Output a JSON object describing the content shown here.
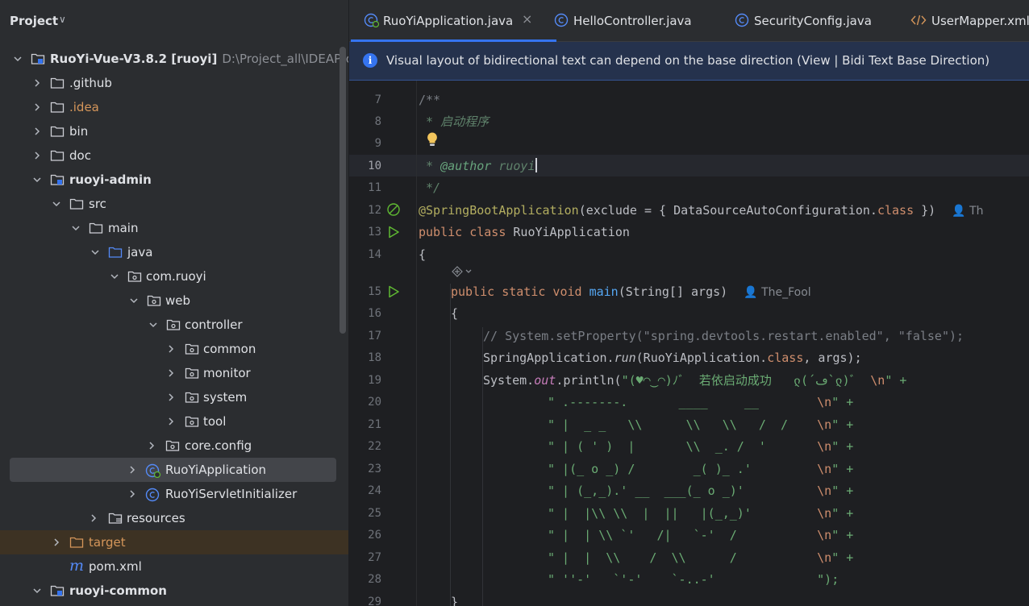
{
  "project_panel": {
    "title": "Project",
    "tree": [
      {
        "label": "RuoYi-Vue-V3.8.2",
        "badge": "[ruoyi]",
        "path": "D:\\Project_all\\IDEAProjects",
        "expanded": true,
        "icon": "module-folder-icon"
      },
      {
        "label": ".github",
        "expanded": false,
        "icon": "folder-icon"
      },
      {
        "label": ".idea",
        "expanded": false,
        "icon": "folder-icon"
      },
      {
        "label": "bin",
        "expanded": false,
        "icon": "folder-icon"
      },
      {
        "label": "doc",
        "expanded": false,
        "icon": "folder-icon"
      },
      {
        "label": "ruoyi-admin",
        "expanded": true,
        "icon": "module-folder-icon"
      },
      {
        "label": "src",
        "expanded": true,
        "icon": "folder-icon"
      },
      {
        "label": "main",
        "expanded": true,
        "icon": "folder-icon"
      },
      {
        "label": "java",
        "expanded": true,
        "icon": "source-folder-icon"
      },
      {
        "label": "com.ruoyi",
        "expanded": true,
        "icon": "package-icon"
      },
      {
        "label": "web",
        "expanded": true,
        "icon": "package-icon"
      },
      {
        "label": "controller",
        "expanded": true,
        "icon": "package-icon"
      },
      {
        "label": "common",
        "expanded": false,
        "icon": "package-icon"
      },
      {
        "label": "monitor",
        "expanded": false,
        "icon": "package-icon"
      },
      {
        "label": "system",
        "expanded": false,
        "icon": "package-icon"
      },
      {
        "label": "tool",
        "expanded": false,
        "icon": "package-icon"
      },
      {
        "label": "core.config",
        "expanded": false,
        "icon": "package-icon"
      },
      {
        "label": "RuoYiApplication",
        "expanded": false,
        "icon": "spring-boot-class-icon"
      },
      {
        "label": "RuoYiServletInitializer",
        "expanded": false,
        "icon": "class-icon"
      },
      {
        "label": "resources",
        "expanded": false,
        "icon": "resources-folder-icon"
      },
      {
        "label": "target",
        "expanded": false,
        "icon": "excluded-folder-icon"
      },
      {
        "label": "pom.xml",
        "icon": "maven-icon"
      },
      {
        "label": "ruoyi-common",
        "expanded": true,
        "icon": "module-folder-icon"
      }
    ]
  },
  "tabs": [
    {
      "label": "RuoYiApplication.java",
      "active": true,
      "close": "×",
      "icon": "spring-boot-class-icon"
    },
    {
      "label": "HelloController.java",
      "icon": "class-icon"
    },
    {
      "label": "SecurityConfig.java",
      "icon": "class-icon"
    },
    {
      "label": "UserMapper.xml",
      "icon": "xml-icon"
    }
  ],
  "notice": {
    "icon": "i",
    "text": "Visual layout of bidirectional text can depend on the base direction (View | Bidi Text Base Direction)"
  },
  "editor": {
    "line_numbers": [
      "7",
      "8",
      "9",
      "10",
      "11",
      "12",
      "13",
      "14",
      "15",
      "16",
      "17",
      "18",
      "19",
      "20",
      "21",
      "22",
      "23",
      "24",
      "25",
      "26",
      "27",
      "28",
      "29"
    ],
    "current_line": "10",
    "code": {
      "l7": "/**",
      "l8": " * 启动程序",
      "l10_star": " * ",
      "l10_tag": "@author",
      "l10_val": " ruoyi",
      "l11": " */",
      "l12_ann": "@SpringBootApplication",
      "l12_rest": "(exclude = { DataSourceAutoConfiguration.",
      "l12_kw": "class",
      "l12_end": " })",
      "l12_hint": "Th",
      "l13_kw": "public class",
      "l13_name": " RuoYiApplication",
      "l14": "{",
      "l15_kw": "public static void",
      "l15_fn": "main",
      "l15_rest": "(String[] args)",
      "l15_hint": "The_Fool",
      "l16": "{",
      "l17": "// System.setProperty(\"spring.devtools.restart.enabled\", \"false\");",
      "l18_a": "SpringApplication.",
      "l18_run": "run",
      "l18_b": "(RuoYiApplication.",
      "l18_kw": "class",
      "l18_c": ", args);",
      "l19_a": "System.",
      "l19_out": "out",
      "l19_b": ".println(",
      "l19_str": "\"(♥◠‿◠)ﾉﾞ  若依启动成功   ლ(´ڡ`ლ)ﾞ  ",
      "l19_esc": "\\n",
      "l19_end": "\" +",
      "art": [
        "\" .-------.       ____     __        ",
        "\" |  _ _   \\\\      \\\\   \\\\   /  /    ",
        "\" | ( ' )  |       \\\\  _. /  '       ",
        "\" |(_ o _) /        _( )_ .'         ",
        "\" | (_,_).' __  ___(_ o _)'          ",
        "\" |  |\\\\ \\\\  |  ||   |(_,_)'         ",
        "\" |  | \\\\ `'   /|   `-'  /           ",
        "\" |  |  \\\\    /  \\\\      /           ",
        "\" ''-'   `'-'    `-..-'              "
      ],
      "art_esc": "\\n",
      "art_end": "\" +",
      "art_last_end": "\");",
      "l29": "}"
    }
  }
}
